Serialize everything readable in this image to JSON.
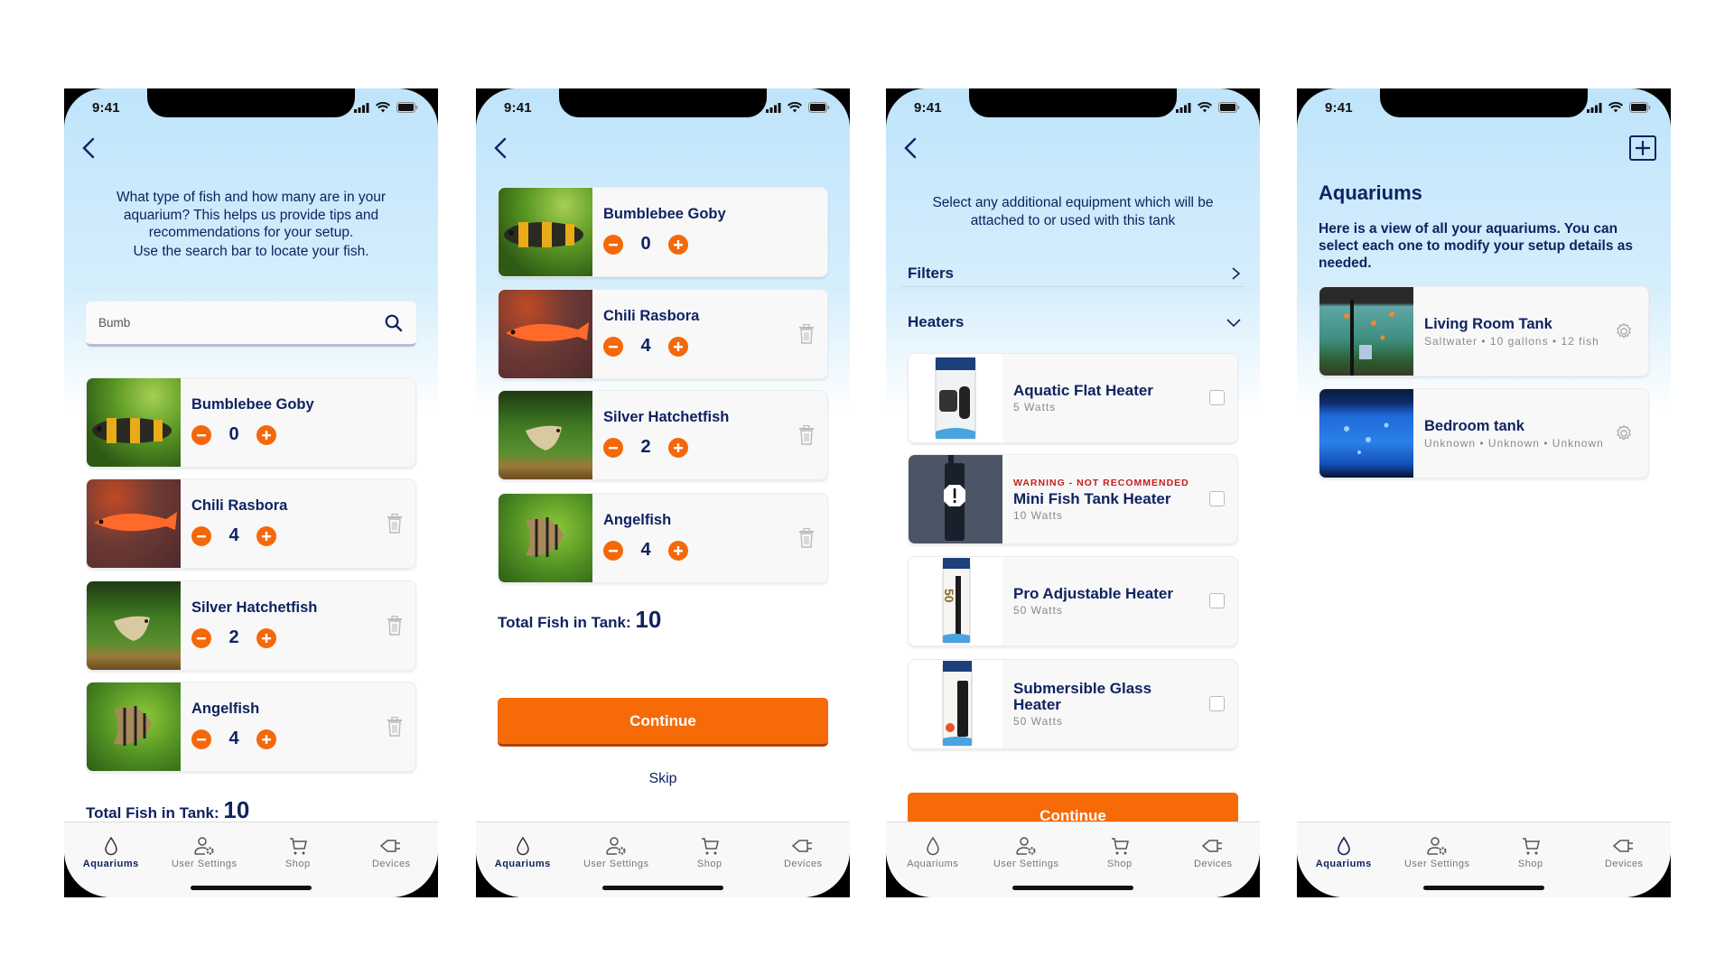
{
  "status_bar": {
    "time": "9:41"
  },
  "tab_bar": {
    "tabs": [
      {
        "label": "Aquariums",
        "icon": "droplet-icon"
      },
      {
        "label": "User Settings",
        "icon": "user-gear-icon"
      },
      {
        "label": "Shop",
        "icon": "cart-icon"
      },
      {
        "label": "Devices",
        "icon": "plug-icon"
      }
    ]
  },
  "colors": {
    "accent": "#f66a08",
    "navy": "#0f2360",
    "warning": "#c3201c"
  },
  "screen1": {
    "intro": "What type of fish and how many are in your aquarium? This helps us provide tips and recommendations for your setup.",
    "intro2": "Use the search bar to locate your fish.",
    "search": {
      "value": "Bumb",
      "placeholder": "Search"
    },
    "fish": [
      {
        "name": "Bumblebee Goby",
        "count": "0",
        "deletable": false
      },
      {
        "name": "Chili Rasbora",
        "count": "4",
        "deletable": true
      },
      {
        "name": "Silver Hatchetfish",
        "count": "2",
        "deletable": true
      },
      {
        "name": "Angelfish",
        "count": "4",
        "deletable": true
      }
    ],
    "total_label": "Total Fish in Tank:",
    "total_value": "10",
    "active_tab": "Aquariums"
  },
  "screen2": {
    "fish": [
      {
        "name": "Bumblebee Goby",
        "count": "0",
        "deletable": false
      },
      {
        "name": "Chili Rasbora",
        "count": "4",
        "deletable": true
      },
      {
        "name": "Silver Hatchetfish",
        "count": "2",
        "deletable": true
      },
      {
        "name": "Angelfish",
        "count": "4",
        "deletable": true
      }
    ],
    "total_label": "Total Fish in Tank:",
    "total_value": "10",
    "continue_label": "Continue",
    "skip_label": "Skip",
    "active_tab": "Aquariums"
  },
  "screen3": {
    "intro": "Select any additional equipment which will be attached to or used with this tank",
    "sections": [
      {
        "label": "Filters",
        "state": "collapsed"
      },
      {
        "label": "Heaters",
        "state": "expanded"
      }
    ],
    "heaters": [
      {
        "name": "Aquatic Flat Heater",
        "sub": "5 Watts",
        "warning": "",
        "checked": false
      },
      {
        "name": "Mini Fish Tank Heater",
        "sub": "10 Watts",
        "warning": "WARNING - NOT RECOMMENDED",
        "checked": false
      },
      {
        "name": "Pro Adjustable Heater",
        "sub": "50 Watts",
        "warning": "",
        "checked": false
      },
      {
        "name": "Submersible Glass Heater",
        "sub": "50 Watts",
        "warning": "",
        "checked": false
      }
    ],
    "continue_label": "Continue",
    "active_tab": "none"
  },
  "screen4": {
    "title": "Aquariums",
    "description": "Here is a view of all your aquariums. You can select each one to modify your setup details as needed.",
    "aquariums": [
      {
        "name": "Living Room Tank",
        "meta": "Saltwater • 10 gallons • 12 fish"
      },
      {
        "name": "Bedroom tank",
        "meta": "Unknown • Unknown • Unknown"
      }
    ],
    "active_tab": "Aquariums"
  }
}
